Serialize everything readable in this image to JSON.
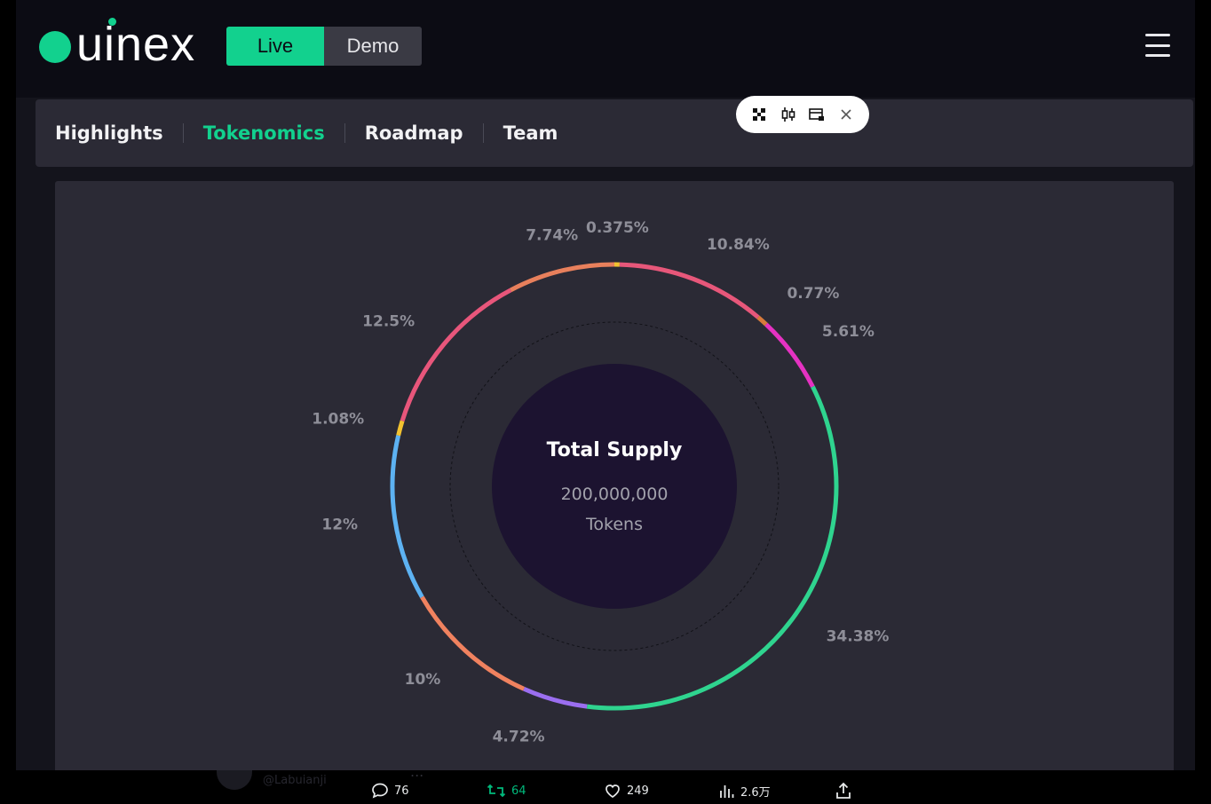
{
  "header": {
    "logo_text": "uinex",
    "mode_live_label": "Live",
    "mode_demo_label": "Demo"
  },
  "tabs": [
    {
      "label": "Highlights",
      "active": false
    },
    {
      "label": "Tokenomics",
      "active": true
    },
    {
      "label": "Roadmap",
      "active": false
    },
    {
      "label": "Team",
      "active": false
    }
  ],
  "colors": {
    "accent": "#12d18e",
    "panel": "#2b2a35",
    "center": "#1c1330",
    "label": "#8e8e98"
  },
  "floating_toolbar": {
    "icons": [
      "qr-code-icon",
      "candlestick-icon",
      "card-icon",
      "close-icon"
    ]
  },
  "chart_data": {
    "type": "pie",
    "variant": "donut",
    "center_title": "Total Supply",
    "center_value": "200,000,000",
    "center_unit": "Tokens",
    "slices": [
      {
        "label": "0.375%",
        "value": 0.375,
        "color": "#f2c230"
      },
      {
        "label": "10.84%",
        "value": 10.84,
        "color": "#e7577a"
      },
      {
        "label": "0.77%",
        "value": 0.77,
        "color": "#d77a3c"
      },
      {
        "label": "5.61%",
        "value": 5.61,
        "color": "#e532c2"
      },
      {
        "label": "34.38%",
        "value": 34.38,
        "color": "#2fd48f"
      },
      {
        "label": "4.72%",
        "value": 4.72,
        "color": "#9b6ef0"
      },
      {
        "label": "10%",
        "value": 10,
        "color": "#f0825f"
      },
      {
        "label": "12%",
        "value": 12,
        "color": "#5db2f2"
      },
      {
        "label": "1.08%",
        "value": 1.08,
        "color": "#f2c230"
      },
      {
        "label": "12.5%",
        "value": 12.5,
        "color": "#e8567b"
      },
      {
        "label": "7.74%",
        "value": 7.74,
        "color": "#e8805c"
      }
    ]
  },
  "bottom_bar": {
    "ghost_handle": "@Labuianji",
    "ghost_dots": "...",
    "replies": "76",
    "retweets": "64",
    "likes": "249",
    "views": "2.6万"
  }
}
